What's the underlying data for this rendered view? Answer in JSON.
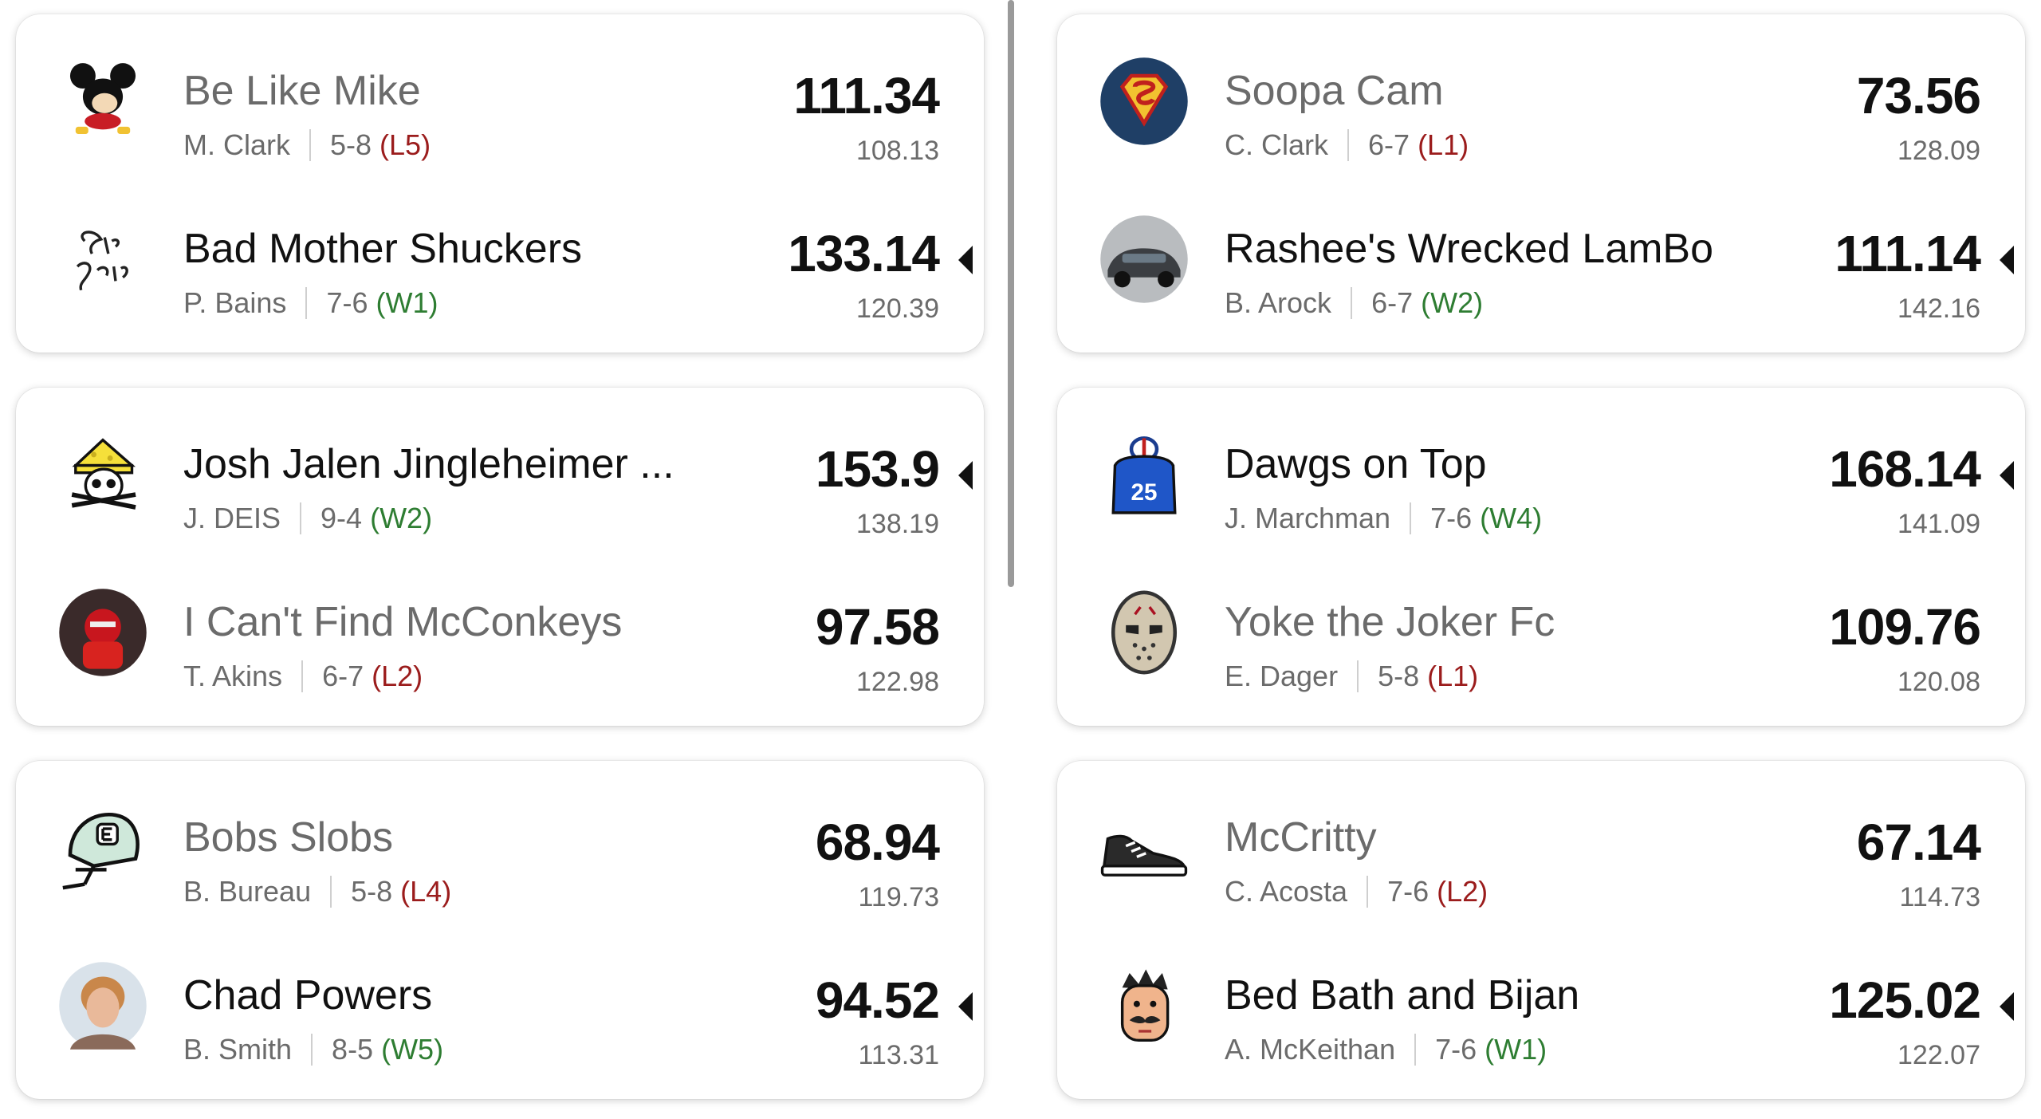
{
  "matchups_left": [
    {
      "top": {
        "name": "Be Like Mike",
        "owner": "M. Clark",
        "record": "5-8",
        "streak": "(L5)",
        "score": "111.34",
        "proj": "108.13",
        "icon": "mickey-avatar-icon"
      },
      "bottom": {
        "name": "Bad Mother Shuckers",
        "owner": "P. Bains",
        "record": "7-6",
        "streak": "(W1)",
        "score": "133.14",
        "proj": "120.39",
        "icon": "shuck-yeah-logo-icon"
      }
    },
    {
      "top": {
        "name": "Josh Jalen Jingleheimer ...",
        "owner": "J. DEIS",
        "record": "9-4",
        "streak": "(W2)",
        "score": "153.9",
        "proj": "138.19",
        "icon": "cheese-skull-icon"
      },
      "bottom": {
        "name": "I Can't Find McConkeys",
        "owner": "T. Akins",
        "record": "6-7",
        "streak": "(L2)",
        "score": "97.58",
        "proj": "122.98",
        "icon": "football-player-photo-icon"
      }
    },
    {
      "top": {
        "name": "Bobs Slobs",
        "owner": "B. Bureau",
        "record": "5-8",
        "streak": "(L4)",
        "score": "68.94",
        "proj": "119.73",
        "icon": "helmet-icon"
      },
      "bottom": {
        "name": "Chad Powers",
        "owner": "B. Smith",
        "record": "8-5",
        "streak": "(W5)",
        "score": "94.52",
        "proj": "113.31",
        "icon": "person-photo-icon"
      }
    }
  ],
  "matchups_right": [
    {
      "top": {
        "name": "Soopa Cam",
        "owner": "C. Clark",
        "record": "6-7",
        "streak": "(L1)",
        "score": "73.56",
        "proj": "128.09",
        "icon": "superman-logo-icon"
      },
      "bottom": {
        "name": "Rashee's Wrecked LamBo",
        "owner": "B. Arock",
        "record": "6-7",
        "streak": "(W2)",
        "score": "111.14",
        "proj": "142.16",
        "icon": "car-photo-icon"
      }
    },
    {
      "top": {
        "name": "Dawgs on Top",
        "owner": "J. Marchman",
        "record": "7-6",
        "streak": "(W4)",
        "score": "168.14",
        "proj": "141.09",
        "icon": "jersey-icon"
      },
      "bottom": {
        "name": "Yoke the Joker Fc",
        "owner": "E. Dager",
        "record": "5-8",
        "streak": "(L1)",
        "score": "109.76",
        "proj": "120.08",
        "icon": "hockey-mask-icon"
      }
    },
    {
      "top": {
        "name": "McCritty",
        "owner": "C. Acosta",
        "record": "7-6",
        "streak": "(L2)",
        "score": "67.14",
        "proj": "114.73",
        "icon": "sneaker-icon"
      },
      "bottom": {
        "name": "Bed Bath and Bijan",
        "owner": "A. McKeithan",
        "record": "7-6",
        "streak": "(W1)",
        "score": "125.02",
        "proj": "122.07",
        "icon": "mustache-face-icon"
      }
    }
  ],
  "jersey_number": "25",
  "colors": {
    "win_streak": "#2e7d32",
    "loss_streak": "#9b1c1c",
    "muted": "#6b6b6b"
  }
}
